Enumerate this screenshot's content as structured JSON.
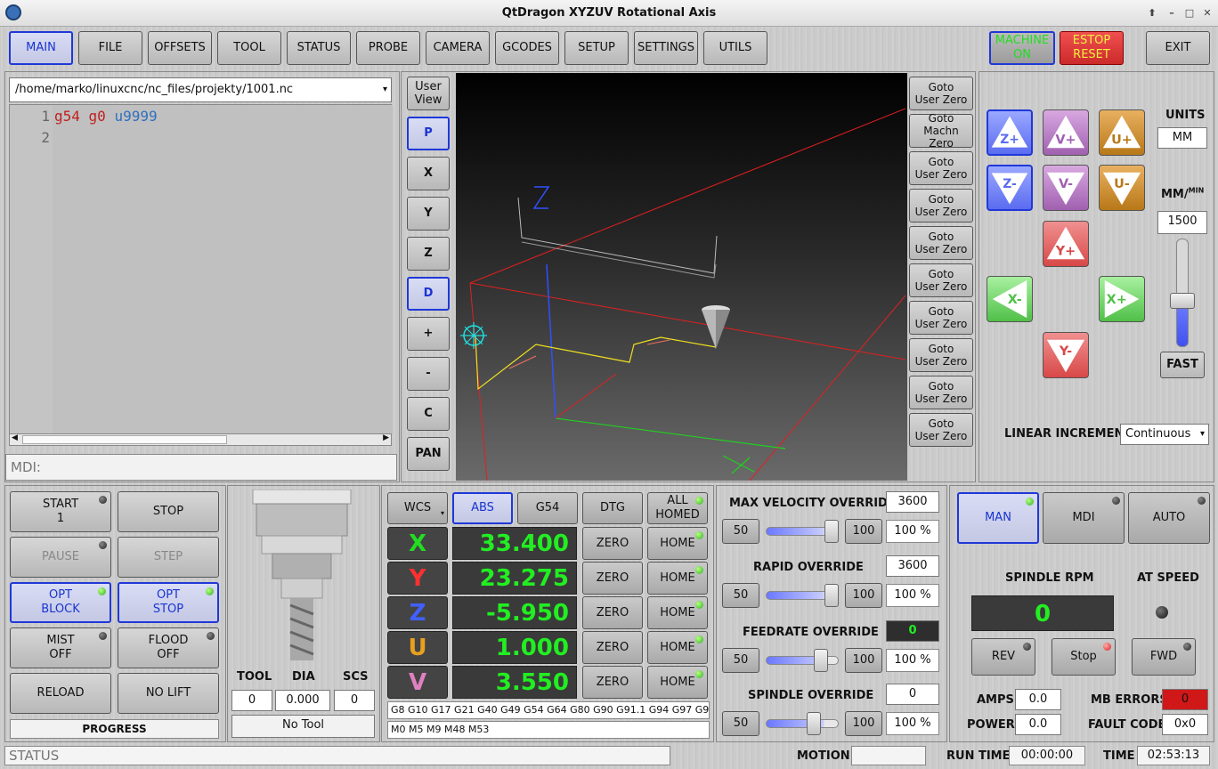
{
  "window": {
    "title": "QtDragon XYZUV Rotational Axis"
  },
  "nav": {
    "tabs": [
      "MAIN",
      "FILE",
      "OFFSETS",
      "TOOL",
      "STATUS",
      "PROBE",
      "CAMERA",
      "GCODES",
      "SETUP",
      "SETTINGS",
      "UTILS"
    ],
    "machine_label": "MACHINE\nON",
    "estop_label": "ESTOP\nRESET",
    "exit_label": "EXIT"
  },
  "editor": {
    "file_path": "/home/marko/linuxcnc/nc_files/projekty/1001.nc",
    "line_numbers": [
      "1",
      "2"
    ],
    "code_tokens": [
      "g54",
      "g0",
      "u9999"
    ],
    "mdi_placeholder": "MDI:"
  },
  "view_buttons": [
    "User\nView",
    "P",
    "X",
    "Y",
    "Z",
    "D",
    "+",
    "-",
    "C",
    "PAN"
  ],
  "goto_buttons": [
    "Goto\nUser Zero",
    "Goto\nMachn Zero",
    "Goto\nUser Zero",
    "Goto\nUser Zero",
    "Goto\nUser Zero",
    "Goto\nUser Zero",
    "Goto\nUser Zero",
    "Goto\nUser Zero",
    "Goto\nUser Zero",
    "Goto\nUser Zero"
  ],
  "jog": {
    "buttons": [
      "Z+",
      "Z-",
      "V+",
      "V-",
      "U+",
      "U-",
      "Y+",
      "Y-",
      "X-",
      "X+"
    ],
    "units_label": "UNITS",
    "units_value": "MM",
    "rate_label": "MM/MIN",
    "rate_value": "1500",
    "fast_label": "FAST",
    "increment_label": "LINEAR INCREMENT",
    "increment_value": "Continuous"
  },
  "controls": {
    "start": "START\n1",
    "stop": "STOP",
    "pause": "PAUSE",
    "step": "STEP",
    "opt_block": "OPT\nBLOCK",
    "opt_stop": "OPT\nSTOP",
    "mist": "MIST\nOFF",
    "flood": "FLOOD\nOFF",
    "reload": "RELOAD",
    "no_lift": "NO LIFT",
    "progress": "PROGRESS"
  },
  "tool": {
    "tool_label": "TOOL",
    "dia_label": "DIA",
    "scs_label": "SCS",
    "tool_value": "0",
    "dia_value": "0.000",
    "scs_value": "0",
    "tool_name": "No Tool"
  },
  "dro": {
    "wcs_label": "WCS",
    "abs_label": "ABS",
    "g54_label": "G54",
    "dtg_label": "DTG",
    "all_homed_label": "ALL\nHOMED",
    "axes": [
      {
        "letter": "X",
        "value": "33.400",
        "color": "#22dd22"
      },
      {
        "letter": "Y",
        "value": "23.275",
        "color": "#ff3030"
      },
      {
        "letter": "Z",
        "value": "-5.950",
        "color": "#4060ff"
      },
      {
        "letter": "U",
        "value": "1.000",
        "color": "#e8a020"
      },
      {
        "letter": "V",
        "value": "3.550",
        "color": "#e080c0"
      }
    ],
    "zero_label": "ZERO",
    "home_label": "HOME",
    "active_gcodes": "G8 G10 G17 G21 G40 G49 G54 G64 G80 G90 G91.1 G94 G97 G99",
    "active_mcodes": "M0 M5 M9 M48 M53"
  },
  "overrides": {
    "max_velocity": {
      "label": "MAX VELOCITY OVERRIDE",
      "value": "3600",
      "low": "50",
      "high": "100",
      "percent": "100 %",
      "level": 1.0
    },
    "rapid": {
      "label": "RAPID OVERRIDE",
      "value": "3600",
      "low": "50",
      "high": "100",
      "percent": "100 %",
      "level": 1.0
    },
    "feedrate": {
      "label": "FEEDRATE OVERRIDE",
      "value": "0",
      "low": "50",
      "high": "100",
      "percent": "100 %",
      "level": 0.85
    },
    "spindle": {
      "label": "SPINDLE OVERRIDE",
      "value": "0",
      "low": "50",
      "high": "100",
      "percent": "100 %",
      "level": 0.7
    }
  },
  "spindle": {
    "man": "MAN",
    "mdi": "MDI",
    "auto": "AUTO",
    "rpm_label": "SPINDLE RPM",
    "at_speed_label": "AT SPEED",
    "rpm_value": "0",
    "rev": "REV",
    "stop": "Stop",
    "fwd": "FWD",
    "amps_label": "AMPS",
    "amps_value": "0.0",
    "mb_errors_label": "MB ERRORS",
    "mb_errors_value": "0",
    "power_label": "POWER",
    "power_value": "0.0",
    "fault_label": "FAULT CODE",
    "fault_value": "0x0"
  },
  "statusbar": {
    "status": "STATUS",
    "motion_label": "MOTION",
    "run_time_label": "RUN TIME",
    "run_time_value": "00:00:00",
    "time_label": "TIME",
    "time_value": "02:53:13"
  },
  "colors": {
    "accent": "#2038d8",
    "dro_green": "#22ee22",
    "estop": "#cc2a2a"
  }
}
